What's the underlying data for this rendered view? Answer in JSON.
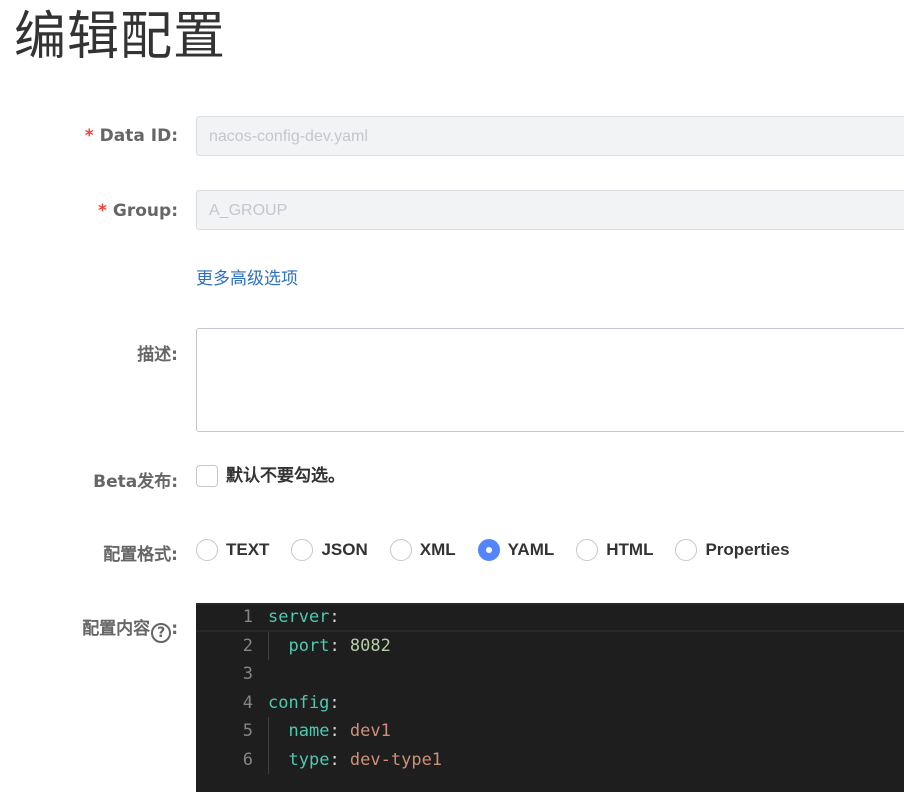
{
  "page": {
    "title": "编辑配置"
  },
  "form": {
    "data_id": {
      "label": "Data ID:",
      "value": "nacos-config-dev.yaml",
      "required": true
    },
    "group": {
      "label": "Group:",
      "value": "A_GROUP",
      "required": true
    },
    "required_mark": "*",
    "advanced_link": "更多高级选项",
    "description": {
      "label": "描述:",
      "value": ""
    },
    "beta": {
      "label": "Beta发布:",
      "checkbox_text": "默认不要勾选。",
      "checked": false
    },
    "format": {
      "label": "配置格式:",
      "options": [
        "TEXT",
        "JSON",
        "XML",
        "YAML",
        "HTML",
        "Properties"
      ],
      "selected": "YAML"
    },
    "content": {
      "label": "配置内容",
      "help_glyph": "?",
      "label_suffix": ":",
      "lines": [
        {
          "num": "1",
          "key": "server",
          "colon": ":",
          "value": "",
          "indent": ""
        },
        {
          "num": "2",
          "key": "port",
          "colon": ":",
          "value": " 8082",
          "indent": "  "
        },
        {
          "num": "3",
          "key": "",
          "colon": "",
          "value": "",
          "indent": ""
        },
        {
          "num": "4",
          "key": "config",
          "colon": ":",
          "value": "",
          "indent": ""
        },
        {
          "num": "5",
          "key": "name",
          "colon": ":",
          "value": " dev1",
          "indent": "  "
        },
        {
          "num": "6",
          "key": "type",
          "colon": ":",
          "value": " dev-type1",
          "indent": "  "
        }
      ]
    }
  },
  "colors": {
    "required": "#f04134",
    "link": "#2f6fbf",
    "radio_checked": "#5584ff",
    "editor_bg": "#1e1e1e",
    "yaml_key": "#4ec9b0",
    "yaml_number": "#b5cea8",
    "yaml_string": "#ce9178"
  }
}
